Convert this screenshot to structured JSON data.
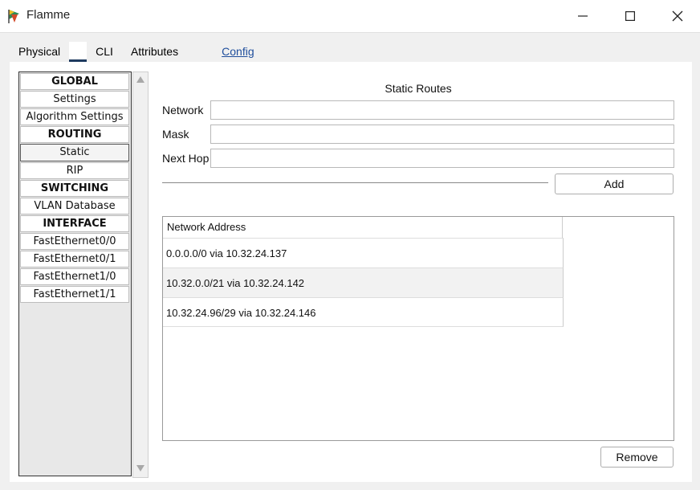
{
  "window": {
    "title": "Flamme",
    "minimize_icon": "minimize-icon",
    "maximize_icon": "maximize-icon",
    "close_icon": "close-icon"
  },
  "tabs": [
    {
      "label": "Physical"
    },
    {
      "label": "Config"
    },
    {
      "label": "CLI"
    },
    {
      "label": "Attributes"
    }
  ],
  "sidebar": {
    "items": [
      {
        "label": "GLOBAL"
      },
      {
        "label": "Settings"
      },
      {
        "label": "Algorithm Settings"
      },
      {
        "label": "ROUTING"
      },
      {
        "label": "Static"
      },
      {
        "label": "RIP"
      },
      {
        "label": "SWITCHING"
      },
      {
        "label": "VLAN Database"
      },
      {
        "label": "INTERFACE"
      },
      {
        "label": "FastEthernet0/0"
      },
      {
        "label": "FastEthernet0/1"
      },
      {
        "label": "FastEthernet1/0"
      },
      {
        "label": "FastEthernet1/1"
      }
    ]
  },
  "form": {
    "title": "Static Routes",
    "network_label": "Network",
    "network_value": "",
    "mask_label": "Mask",
    "mask_value": "",
    "nexthop_label": "Next Hop",
    "nexthop_value": "",
    "add_label": "Add",
    "remove_label": "Remove"
  },
  "routes": {
    "header": "Network Address",
    "rows": [
      {
        "text": "0.0.0.0/0 via 10.32.24.137"
      },
      {
        "text": "10.32.0.0/21 via 10.32.24.142"
      },
      {
        "text": "10.32.24.96/29 via 10.32.24.146"
      }
    ]
  }
}
